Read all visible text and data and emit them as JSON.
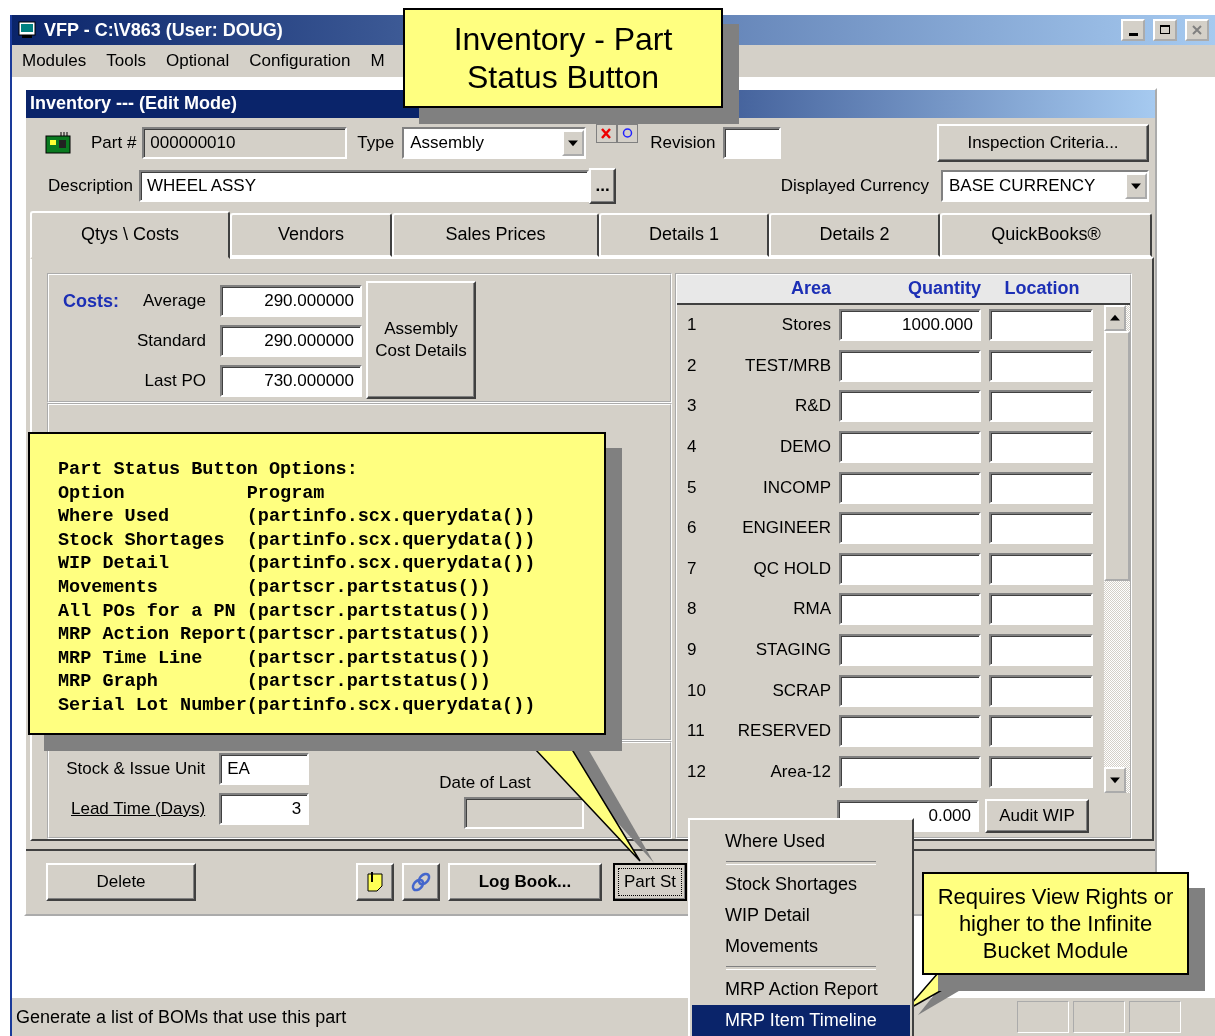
{
  "window": {
    "title": "VFP - C:\\V863  (User: DOUG)"
  },
  "menu_bar": [
    "Modules",
    "Tools",
    "Optional",
    "Configuration",
    "M"
  ],
  "form": {
    "title": "Inventory --- (Edit Mode)",
    "part_number": {
      "label": "Part #",
      "value": "000000010"
    },
    "type": {
      "label": "Type",
      "value": "Assembly"
    },
    "revision": {
      "label": "Revision"
    },
    "inspection_button": "Inspection Criteria...",
    "description": {
      "label": "Description",
      "value": "WHEEL ASSY"
    },
    "ellipsis_button": "...",
    "currency": {
      "label": "Displayed Currency",
      "value": "BASE CURRENCY"
    },
    "tabs": [
      {
        "label": "Qtys \\ Costs",
        "selected": true
      },
      {
        "label": "Vendors",
        "selected": false
      },
      {
        "label": "Sales Prices",
        "selected": false
      },
      {
        "label": "Details 1",
        "selected": false
      },
      {
        "label": "Details 2",
        "selected": false
      },
      {
        "label": "QuickBooks®",
        "selected": false
      }
    ],
    "costs": {
      "heading": "Costs:",
      "rows": [
        {
          "label": "Average",
          "value": "290.000000"
        },
        {
          "label": "Standard",
          "value": "290.000000"
        },
        {
          "label": "Last PO",
          "value": "730.000000"
        }
      ],
      "button": "Assembly Cost Details"
    },
    "stock_unit": {
      "label": "Stock & Issue Unit",
      "value": "EA"
    },
    "lead_time": {
      "label": "Lead Time (Days)",
      "value": "3"
    },
    "last_count": {
      "label": "Date of Last"
    },
    "stock_grid": {
      "columns": [
        "Area",
        "Quantity",
        "Location"
      ],
      "rows": [
        {
          "number": "1",
          "area": "Stores",
          "quantity": "1000.000"
        },
        {
          "number": "2",
          "area": "TEST/MRB"
        },
        {
          "number": "3",
          "area": "R&D"
        },
        {
          "number": "4",
          "area": "DEMO"
        },
        {
          "number": "5",
          "area": "INCOMP"
        },
        {
          "number": "6",
          "area": "ENGINEER"
        },
        {
          "number": "7",
          "area": "QC HOLD"
        },
        {
          "number": "8",
          "area": "RMA"
        },
        {
          "number": "9",
          "area": "STAGING"
        },
        {
          "number": "10",
          "area": "SCRAP"
        },
        {
          "number": "11",
          "area": "RESERVED"
        },
        {
          "number": "12",
          "area": "Area-12"
        }
      ]
    },
    "wip": {
      "value": "0.000",
      "button": "Audit WIP"
    },
    "buttons": {
      "delete": "Delete",
      "log_book": "Log Book...",
      "part_status": "Part St"
    }
  },
  "status_bar": "Generate a list of BOMs that use this part",
  "popup_menu": [
    {
      "kind": "item",
      "label": "Where Used",
      "selected": false
    },
    {
      "kind": "separator"
    },
    {
      "kind": "item",
      "label": "Stock Shortages",
      "selected": false
    },
    {
      "kind": "item",
      "label": "WIP Detail",
      "selected": false
    },
    {
      "kind": "item",
      "label": "Movements",
      "selected": false
    },
    {
      "kind": "separator"
    },
    {
      "kind": "item",
      "label": "MRP Action Report",
      "selected": false
    },
    {
      "kind": "item",
      "label": "MRP Item Timeline",
      "selected": true
    }
  ],
  "callouts": {
    "title": "Inventory - Part Status Button",
    "options": {
      "heading": "Part Status Button Options:",
      "columns": [
        "Option",
        "Program"
      ],
      "rows": [
        {
          "option": "Where Used",
          "program": "(partinfo.scx.querydata())"
        },
        {
          "option": "Stock Shortages",
          "program": "(partinfo.scx.querydata())"
        },
        {
          "option": "WIP Detail",
          "program": "(partinfo.scx.querydata())"
        },
        {
          "option": "Movements",
          "program": "(partscr.partstatus())"
        },
        {
          "option": "All POs for a PN",
          "program": "(partscr.partstatus())"
        },
        {
          "option": "MRP Action Report",
          "program": "(partscr.partstatus())"
        },
        {
          "option": "MRP Time Line",
          "program": "(partscr.partstatus())"
        },
        {
          "option": "MRP Graph",
          "program": "(partscr.partstatus())"
        },
        {
          "option": "Serial Lot Number",
          "program": "(partinfo.scx.querydata())"
        }
      ]
    },
    "rights": "Requires View Rights or higher to the Infinite Bucket Module"
  }
}
